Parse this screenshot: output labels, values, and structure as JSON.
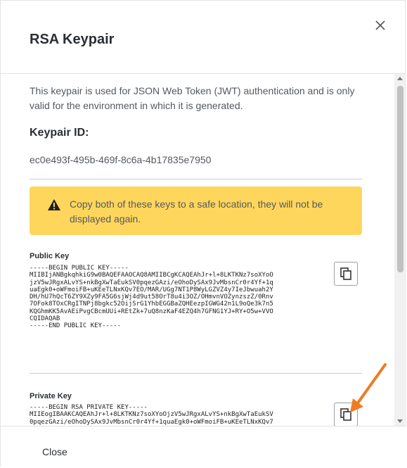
{
  "dialog": {
    "title": "RSA Keypair",
    "close_icon": "close-icon",
    "description": "This keypair is used for JSON Web Token (JWT) authentication and is only valid for the environment in which it is generated.",
    "keypair_id_label": "Keypair ID:",
    "keypair_id": "ec0e493f-495b-469f-8c6a-4b17835e7950",
    "warning": {
      "icon": "warning-icon",
      "text": "Copy both of these keys to a safe location, they will not be displayed again.",
      "color": "#ffd65c"
    },
    "public_key": {
      "label": "Public Key",
      "text": "-----BEGIN PUBLIC KEY-----\nMIIBIjANBgkqhkiG9w0BAQEFAAOCAQ8AMIIBCgKCAQEAhJr+l+8LKTKNz7soXYoO\njzV5wJRgxALvYS+nkBgXwTaEukSV0pqezGAzi/eOhoDySAx9JvMbsnCr0r4Yf+1q\nuaEgk0+oWFmoiFB+uKEeTLNxKQv7EO/MAR/UGg7NT1P8WyLGZVZ4y7IeJbwuah2Y\nDH/hU7hQcT6ZY9XZy9FA5G6sjWj4d9ut58OrT8u4i3OZ/OHmvnVOZynzszZ/0Rnv\n7OFok8TOxCRgITNPj8bgkc52OijSrG1YhbEGGBaZQHEezpIGWG42n1L9oQe3k7n5\nKQGhmKK5AvAEiPvgCBcmUUi+REtZk+7uQ8nzKaF4EZQ4h7GFNG1YJ+RY+O5w+VVO\nCQIDAQAB\n-----END PUBLIC KEY-----",
      "copy_icon": "copy-icon"
    },
    "private_key": {
      "label": "Private Key",
      "text": "-----BEGIN RSA PRIVATE KEY-----\nMIIEogIBAAKCAQEAhJr+l+8LKTKNz7soXYoOjzV5wJRgxALvYS+nkBgXwTaEukSV\n0pqezGAzi/eOhoDySAx9JvMbsnCr0r4Yf+1quaEgk0+oWFmoiFB+uKEeTLNxKQv7",
      "copy_icon": "copy-icon"
    },
    "close_button": "Close",
    "annotation_color": "#f07b22"
  }
}
